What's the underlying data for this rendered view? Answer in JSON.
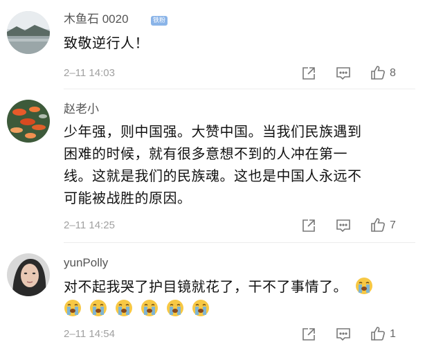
{
  "comments": [
    {
      "username": "木鱼石 0020",
      "badge": "铁粉",
      "text": "致敬逆行人！",
      "timestamp": "2–11 14:03",
      "likes": "8",
      "avatar": "landscape-avatar"
    },
    {
      "username": "赵老小",
      "badge": "",
      "lines": [
        "少年强，则中国强。大赞中国。当我们民族遇到",
        "困难的时候，就有很多意想不到的人冲在第一",
        "线。这就是我们的民族魂。这也是中国人永远不",
        "可能被战胜的原因。"
      ],
      "timestamp": "2–11 14:25",
      "likes": "7",
      "avatar": "koi-fish-avatar"
    },
    {
      "username": "yunPolly",
      "badge": "",
      "text": "对不起我哭了护目镜就花了，干不了事情了。",
      "emoji_inline": "crying-face-emoji",
      "emoji_row_count": 6,
      "timestamp": "2–11 14:54",
      "likes": "1",
      "avatar": "portrait-avatar"
    }
  ],
  "icons": {
    "share": "share-icon",
    "reply": "reply-icon",
    "like": "thumbs-up-icon"
  },
  "colors": {
    "badge": "#8ab4e8",
    "icon": "#777777",
    "timestamp": "#a0a0a0"
  }
}
